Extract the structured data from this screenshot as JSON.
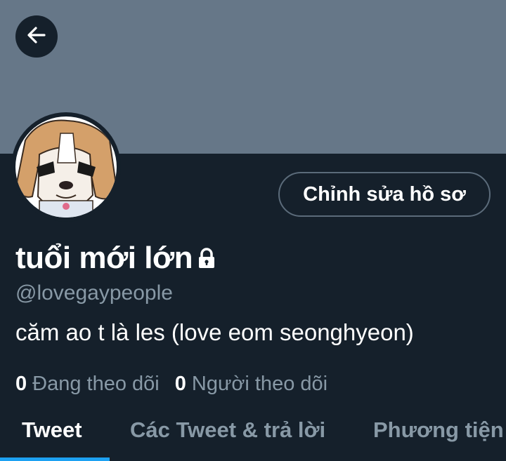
{
  "colors": {
    "background": "#15202b",
    "banner": "#667788",
    "secondary_text": "#8899a6",
    "accent": "#1da1f2"
  },
  "header": {
    "back_icon": "arrow-left-icon"
  },
  "profile": {
    "avatar_icon": "cartoon-dog-avatar",
    "edit_button_label": "Chỉnh sửa hồ sơ",
    "display_name": "tuổi mới lớn",
    "lock_icon": "lock-icon",
    "handle": "@lovegaypeople",
    "bio": "căm ao t là les (love eom seonghyeon)",
    "following_count": "0",
    "following_label": "Đang theo dõi",
    "followers_count": "0",
    "followers_label": "Người theo dõi"
  },
  "tabs": [
    {
      "label": "Tweet",
      "active": true
    },
    {
      "label": "Các Tweet & trả lời",
      "active": false
    },
    {
      "label": "Phương tiện",
      "active": false
    }
  ]
}
